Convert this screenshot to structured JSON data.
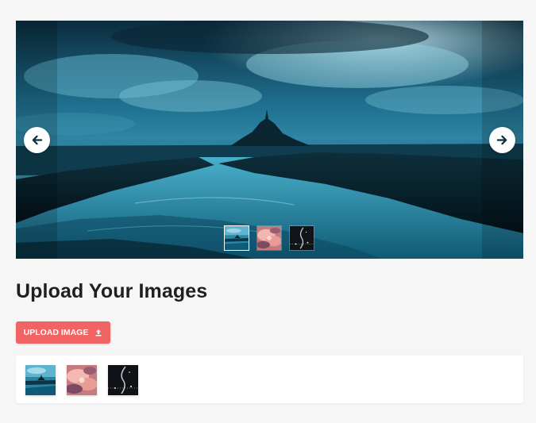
{
  "carousel": {
    "slides": [
      {
        "name": "mont-saint-michel-coast",
        "active": true
      },
      {
        "name": "pink-clouds",
        "active": false
      },
      {
        "name": "night-lights",
        "active": false
      }
    ],
    "prev_icon": "arrow-left-icon",
    "next_icon": "arrow-right-icon"
  },
  "upload_section": {
    "title": "Upload Your Images",
    "button_label": "UPLOAD IMAGE",
    "button_icon": "upload-icon",
    "uploaded_images": [
      {
        "name": "mont-saint-michel-coast"
      },
      {
        "name": "pink-clouds"
      },
      {
        "name": "night-lights"
      }
    ]
  },
  "colors": {
    "page_background": "#f6f6f6",
    "accent": "#f26464",
    "title_text": "#1f1f1f",
    "panel_background": "#ffffff"
  }
}
